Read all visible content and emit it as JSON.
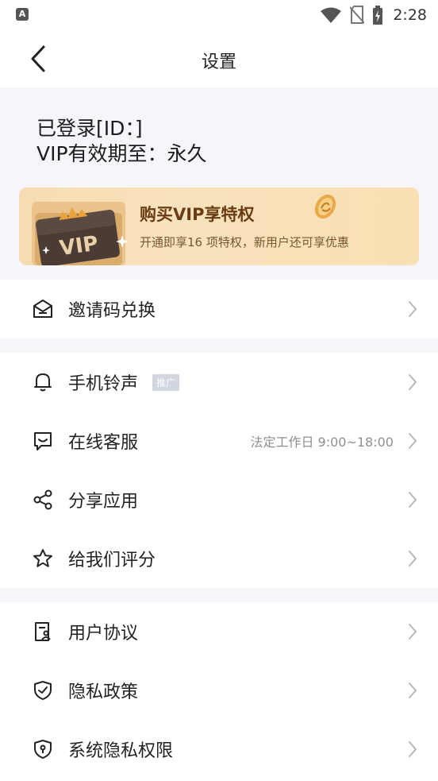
{
  "status_bar": {
    "app_icon_letter": "A",
    "time": "2:28"
  },
  "header": {
    "title": "设置"
  },
  "account": {
    "login_line": "已登录[ID：]",
    "vip_line": "VIP有效期至：永久"
  },
  "vip_banner": {
    "card_text": "VIP",
    "title": "购买VIP享特权",
    "subtitle": "开通即享16 项特权，新用户还可享优惠"
  },
  "sections": {
    "invite": {
      "label": "邀请码兑换"
    },
    "ringtone": {
      "label": "手机铃声",
      "badge": "推广"
    },
    "support": {
      "label": "在线客服",
      "detail": "法定工作日 9:00~18:00"
    },
    "share": {
      "label": "分享应用"
    },
    "rate": {
      "label": "给我们评分"
    },
    "agreement": {
      "label": "用户协议"
    },
    "privacy": {
      "label": "隐私政策"
    },
    "permissions": {
      "label": "系统隐私权限"
    }
  },
  "colors": {
    "page_bg": "#f6f6fa",
    "banner_title": "#6a3c14",
    "chevron": "#b8b8b8",
    "badge_bg": "#d2d6e0"
  },
  "icons": [
    "wifi-icon",
    "no-sim-icon",
    "battery-charging-icon",
    "back-arrow-icon",
    "mail-open-icon",
    "bell-icon",
    "chat-icon",
    "share-icon",
    "star-icon",
    "document-user-icon",
    "shield-check-icon",
    "shield-lock-icon",
    "chevron-right-icon"
  ]
}
